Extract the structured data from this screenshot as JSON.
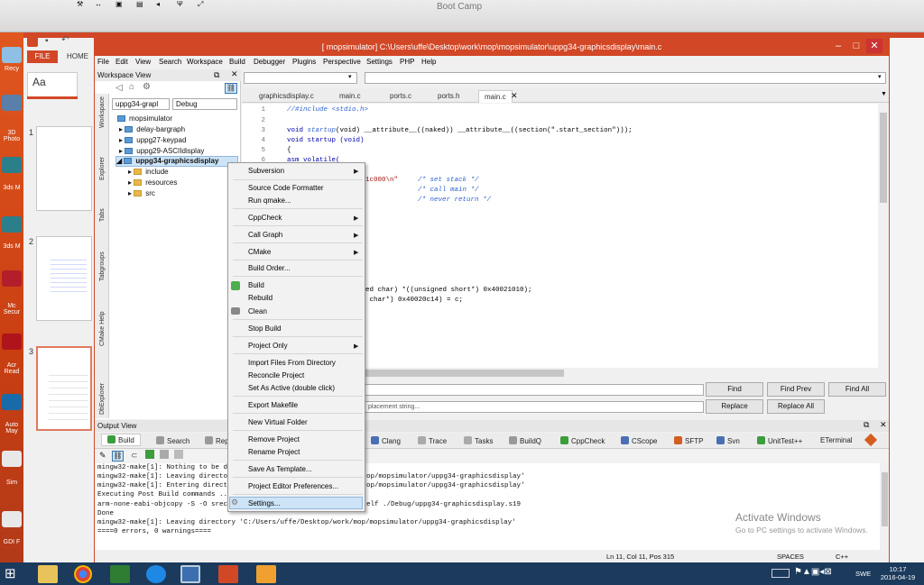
{
  "mac": {
    "title": "Boot Camp"
  },
  "window": {
    "title": "[ mopsimulator] C:\\Users\\uffe\\Desktop\\work\\mop\\mopsimulator\\uppg34-graphicsdisplay\\main.c"
  },
  "ppt": {
    "file_tab": "FILE",
    "home_tab": "HOME",
    "theme_label": "Aa",
    "slide_numbers": [
      "1",
      "2",
      "3"
    ]
  },
  "menu": [
    "File",
    "Edit",
    "View",
    "Search",
    "Workspace",
    "Build",
    "Debugger",
    "Plugins",
    "Perspective",
    "Settings",
    "PHP",
    "Help"
  ],
  "workspace": {
    "title": "Workspace View",
    "project_select": "uppg34-grapl",
    "config_select": "Debug",
    "vertical_tabs": [
      "Workspace",
      "Explorer",
      "Tabs",
      "Tabgroups",
      "CMake Help",
      "DbExplorer"
    ],
    "tree": {
      "root": "mopsimulator",
      "projects": [
        "delay-bargraph",
        "uppg27-keypad",
        "uppg29-ASCIIdisplay",
        "uppg34-graphicsdisplay"
      ],
      "children": [
        "include",
        "resources",
        "src"
      ]
    }
  },
  "tabs": [
    "graphicsdisplay.c",
    "main.c",
    "ports.c",
    "ports.h",
    "main.c"
  ],
  "line_numbers": [
    "1",
    "2",
    "3",
    "4",
    "5",
    "6"
  ],
  "code": {
    "l1": "//#include <stdio.h>",
    "l3a": "void ",
    "l3b": "startup",
    "l3c": "(void) __attribute__((naked)) __attribute__((section(\".start_section\")));",
    "l4": "void startup (void)",
    "l5": "{",
    "l6": "asm volatile(",
    "l7a": "1c000\\n\"",
    "l7b": "/* set stack */",
    "l8": "/* call main */",
    "l9": "/* never return */",
    "l10": "ed char) *((unsigned short*) 0x40021010);",
    "l11": " char*) 0x40020c14) = c;"
  },
  "find": {
    "replace_placeholder": "placement string...",
    "find": "Find",
    "find_prev": "Find Prev",
    "find_all": "Find All",
    "replace": "Replace",
    "replace_all": "Replace All"
  },
  "output": {
    "title": "Output View",
    "tabs": [
      "Build",
      "Search",
      "Rep",
      "Clang",
      "Trace",
      "Tasks",
      "BuildQ",
      "CppCheck",
      "CScope",
      "SFTP",
      "Svn",
      "UnitTest++",
      "ETerminal"
    ],
    "lines": [
      "mingw32-make[1]: Nothing to be d",
      "mingw32-make[1]: Leaving directo",
      "mingw32-make[1]: Entering direct",
      "Executing Post Build commands ..",
      "arm-none-eabi-objcopy -S -O srec",
      "Done",
      "mingw32-make[1]: Leaving directory 'C:/Users/uffe/Desktop/work/mop/mopsimulator/uppg34-graphicsdisplay'",
      "====0 errors, 0 warnings===="
    ],
    "tails": [
      "op/mopsimulator/uppg34-graphicsdisplay'",
      "op/mopsimulator/uppg34-graphicsdisplay'",
      "elf ./Debug/uppg34-graphicsdisplay.s19"
    ]
  },
  "status": {
    "position": "Ln 11, Col 11, Pos 315",
    "indent": "SPACES",
    "lang": "C++"
  },
  "activate": {
    "title": "Activate Windows",
    "sub": "Go to PC settings to activate Windows."
  },
  "context_menu": [
    {
      "label": "Subversion",
      "sub": true
    },
    {
      "label": "Source Code Formatter"
    },
    {
      "label": "Run qmake..."
    },
    {
      "label": "CppCheck",
      "sub": true
    },
    {
      "label": "Call Graph",
      "sub": true
    },
    {
      "label": "CMake",
      "sub": true
    },
    {
      "label": "Build Order..."
    },
    {
      "label": "Build"
    },
    {
      "label": "Rebuild"
    },
    {
      "label": "Clean"
    },
    {
      "label": "Stop Build"
    },
    {
      "label": "Project Only",
      "sub": true
    },
    {
      "label": "Import Files From Directory"
    },
    {
      "label": "Reconcile Project"
    },
    {
      "label": "Set As Active (double click)"
    },
    {
      "label": "Export Makefile"
    },
    {
      "label": "New Virtual Folder"
    },
    {
      "label": "Remove Project"
    },
    {
      "label": "Rename Project"
    },
    {
      "label": "Save As Template..."
    },
    {
      "label": "Project Editor Preferences..."
    },
    {
      "label": "Settings..."
    }
  ],
  "desktop_labels": [
    "Recy",
    "3D Photo",
    "3ds M",
    "3ds M",
    "Mc Secur",
    "Acr Read",
    "Auto May",
    "Sim",
    "GDI F"
  ],
  "taskbar": {
    "lang": "SWE",
    "time": "10:17",
    "date": "2016-04-19"
  }
}
